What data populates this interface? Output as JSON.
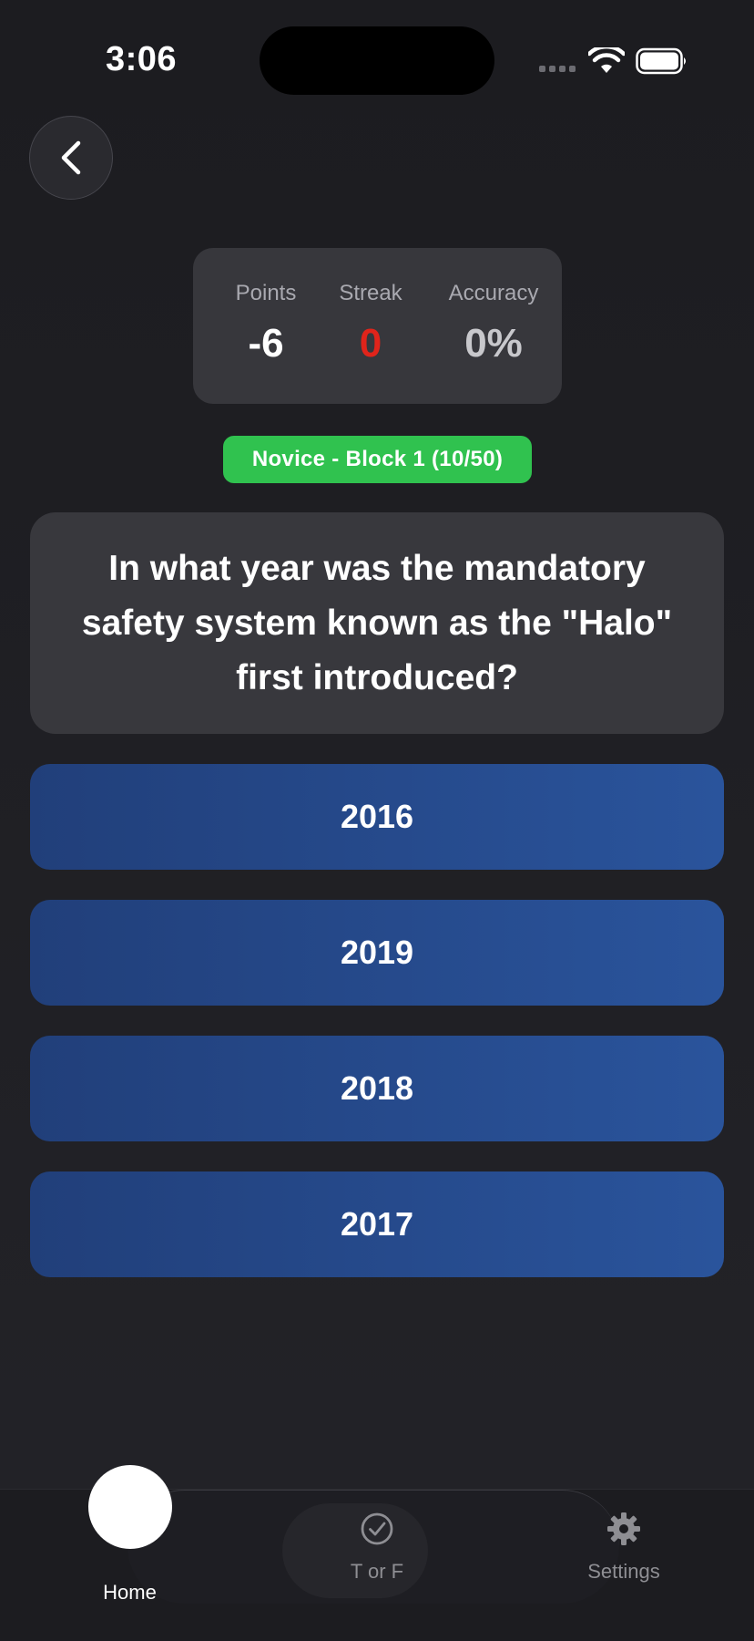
{
  "status_bar": {
    "time": "3:06"
  },
  "stats": {
    "points_label": "Points",
    "points_value": "-6",
    "streak_label": "Streak",
    "streak_value": "0",
    "accuracy_label": "Accuracy",
    "accuracy_value": "0%"
  },
  "level_badge": "Novice - Block 1 (10/50)",
  "question": "In what year was the mandatory safety system known as the \"Halo\" first introduced?",
  "answers": [
    "2016",
    "2019",
    "2018",
    "2017"
  ],
  "tabs": {
    "home_label": "Home",
    "true_false_label": "T or F",
    "settings_label": "Settings"
  },
  "colors": {
    "badge_green": "#30c24f",
    "streak_red": "#e0241b",
    "answer_blue": "#2a549c"
  }
}
